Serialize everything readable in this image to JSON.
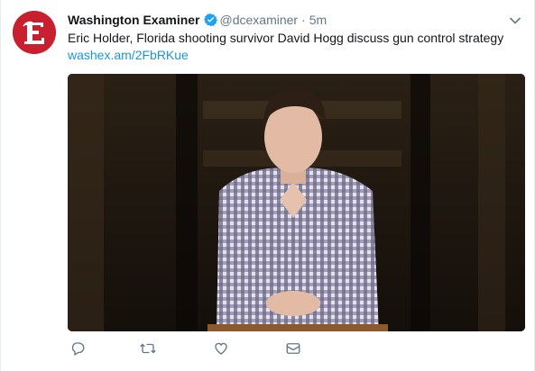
{
  "tweet": {
    "author_name": "Washington Examiner",
    "handle": "@dcexaminer",
    "separator": "·",
    "time": "5m",
    "text": "Eric Holder, Florida shooting survivor David Hogg discuss gun control strategy",
    "link": "washex.am/2FbRKue",
    "verified": true
  },
  "icons": {
    "verified": "verified-badge-icon",
    "caret": "chevron-down-icon",
    "reply": "reply-icon",
    "retweet": "retweet-icon",
    "like": "heart-icon",
    "message": "envelope-icon",
    "logo": "gothic-e-logo"
  },
  "colors": {
    "brand": "#c8202e",
    "link": "#1b95e0",
    "verified": "#1da1f2",
    "muted": "#657786"
  }
}
